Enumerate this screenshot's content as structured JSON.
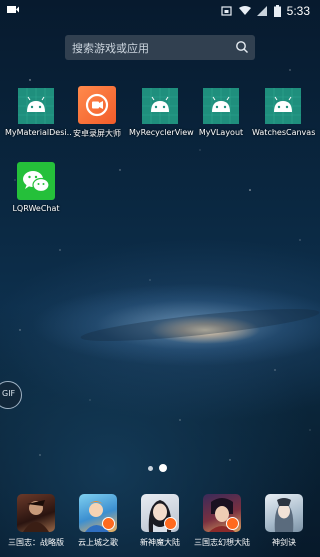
{
  "status": {
    "time": "5:33"
  },
  "search": {
    "placeholder": "搜索游戏或应用"
  },
  "apps": [
    {
      "label": "MyMaterialDesi..",
      "icon": "android-icon"
    },
    {
      "label": "安卓录屏大师",
      "icon": "screen-recorder-icon"
    },
    {
      "label": "MyRecyclerView",
      "icon": "android-icon"
    },
    {
      "label": "MyVLayout",
      "icon": "android-icon"
    },
    {
      "label": "WatchesCanvas",
      "icon": "android-icon"
    },
    {
      "label": "LQRWeChat",
      "icon": "wechat-icon"
    }
  ],
  "gif_bubble": {
    "label": "GIF"
  },
  "page_dots": {
    "count": 2,
    "active": 2
  },
  "dock": [
    {
      "label": "三国志：战略版",
      "icon": "game-icon"
    },
    {
      "label": "云上城之歌",
      "icon": "game-icon"
    },
    {
      "label": "新神魔大陆",
      "icon": "game-icon"
    },
    {
      "label": "三国志幻想大陆",
      "icon": "game-icon"
    },
    {
      "label": "神剑诀",
      "icon": "game-icon"
    }
  ],
  "colors": {
    "android_tile": "#1f8f7d",
    "recorder": "#f25c2a",
    "wechat": "#25c03a",
    "search_bg": "#384656"
  }
}
